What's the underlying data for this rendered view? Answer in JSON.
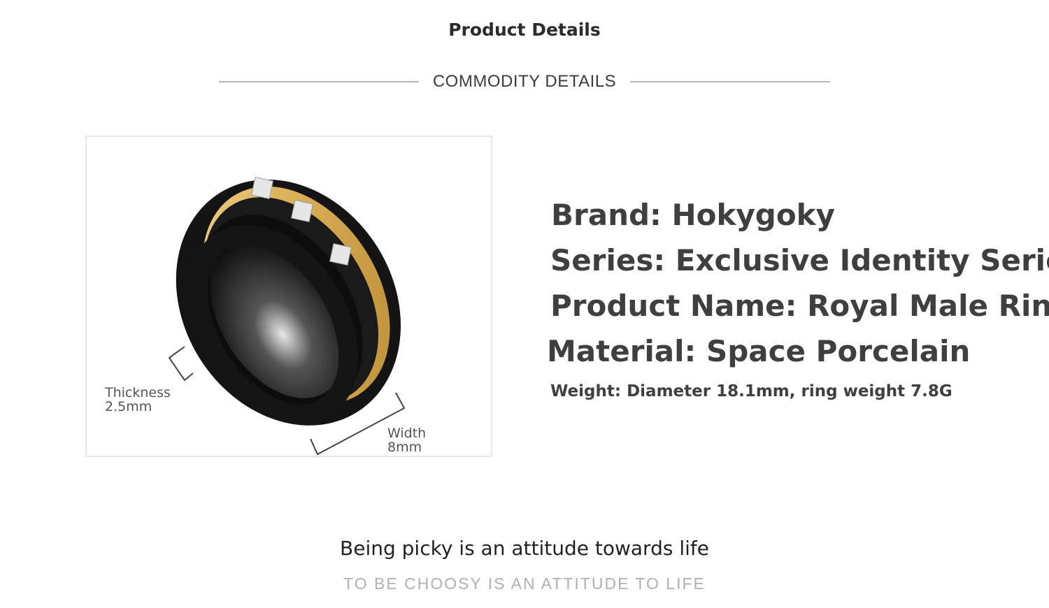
{
  "header": {
    "title": "Product Details",
    "subtitle": "COMMODITY DETAILS"
  },
  "image": {
    "thickness_label": "Thickness",
    "thickness_value": "2.5mm",
    "width_label": "Width",
    "width_value": "8mm"
  },
  "specs": {
    "brand": "Brand: Hokygoky",
    "series": "Series: Exclusive Identity Series",
    "product_name": "Product Name: Royal Male Ring",
    "material": "Material: Space Porcelain",
    "weight": "Weight: Diameter 18.1mm, ring weight 7.8G"
  },
  "footer": {
    "slogan": "Being picky is an attitude towards life",
    "slogan_en": "TO BE CHOOSY IS AN ATTITUDE TO LIFE"
  },
  "colors": {
    "ring_black": "#111111",
    "ring_gold": "#d9ad55",
    "text_dark": "#3f3f3f",
    "divider": "#b5b5b5"
  }
}
